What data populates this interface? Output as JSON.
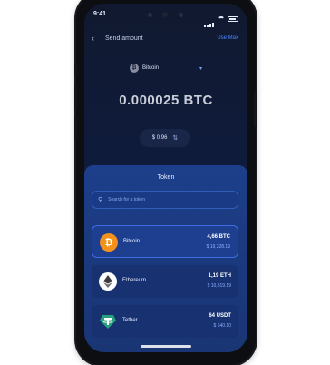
{
  "status_bar": {
    "time": "9:41"
  },
  "header": {
    "back_icon": "arrow-left-icon",
    "title": "Send amount",
    "use_max": "Use Max"
  },
  "token_selector": {
    "selected": "Bitcoin",
    "icon": "bitcoin-icon",
    "chevron": "▾"
  },
  "amount": {
    "value": "0.000025 BTC"
  },
  "fiat_toggle": {
    "value": "$ 0.96",
    "swap_icon": "⇅"
  },
  "token_sheet": {
    "title": "Token",
    "search_placeholder": "Search for a token",
    "tokens": [
      {
        "name": "Bitcoin",
        "balance": "4,66 BTC",
        "usd": "$ 19,328.19",
        "icon": "bitcoin-icon",
        "color": "#f2911b",
        "selected": true
      },
      {
        "name": "Ethereum",
        "balance": "1,19 ETH",
        "usd": "$ 10,319.19",
        "icon": "ethereum-icon",
        "color": "#ffffff",
        "selected": false
      },
      {
        "name": "Tether",
        "balance": "64 USDT",
        "usd": "$ 640.10",
        "icon": "tether-icon",
        "color": "#26a17b",
        "selected": false
      }
    ]
  },
  "colors": {
    "accent": "#4e86ff",
    "sheet": "#1d3e8a",
    "background": "#0f1b3a"
  }
}
